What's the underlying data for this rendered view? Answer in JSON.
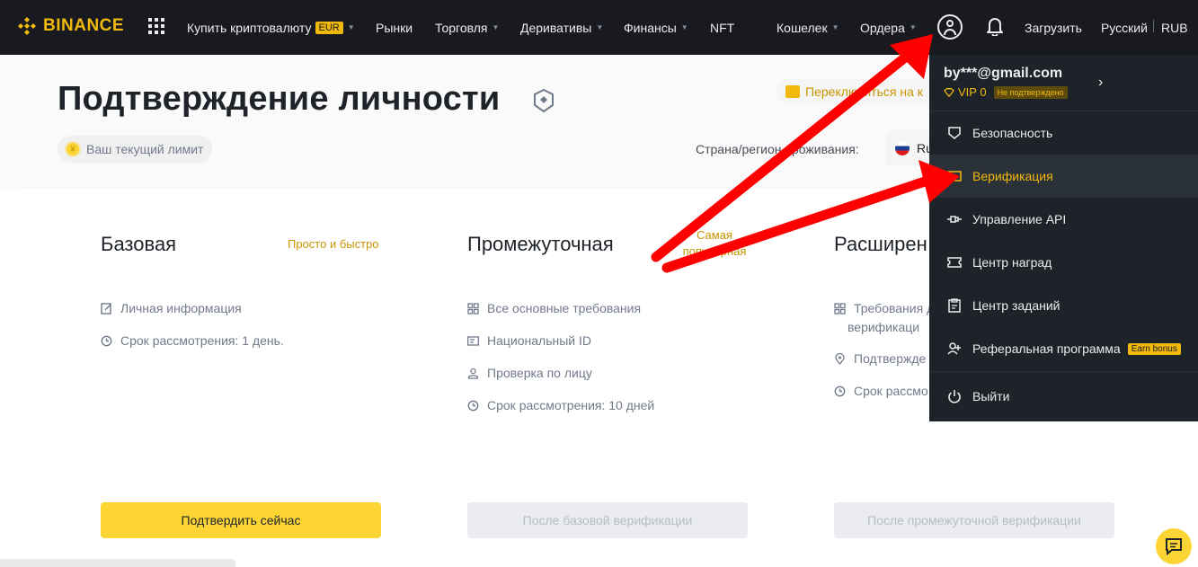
{
  "brand": {
    "name": "BINANCE",
    "color": "#f0b90b"
  },
  "nav": {
    "buy_crypto": "Купить криптовалюту",
    "buy_crypto_badge": "EUR",
    "markets": "Рынки",
    "trade": "Торговля",
    "derivatives": "Деривативы",
    "finance": "Финансы",
    "nft": "NFT",
    "wallet": "Кошелек",
    "orders": "Ордера",
    "download": "Загрузить",
    "language": "Русский",
    "currency": "RUB"
  },
  "header": {
    "title": "Подтверждение личности",
    "limit_label": "Ваш текущий лимит",
    "switch_label": "Переключиться на к",
    "country_label": "Страна/регион проживания:",
    "country_value": "Ru"
  },
  "tiers": [
    {
      "title": "Базовая",
      "tag": "Просто и быстро",
      "requirements": [
        "Личная информация",
        "Срок рассмотрения: 1 день."
      ],
      "button": "Подтвердить сейчас"
    },
    {
      "title": "Промежуточная",
      "tag_line1": "Самая",
      "tag_line2": "популярная",
      "requirements": [
        "Все основные требования",
        "Национальный ID",
        "Проверка по лицу",
        "Срок рассмотрения: 10 дней"
      ],
      "button": "После базовой верификации"
    },
    {
      "title": "Расширен",
      "requirements_line1": "Требования д",
      "requirements_line2": "верификаци",
      "requirements": [
        "Подтвержде",
        "Срок рассмо"
      ],
      "button": "После промежуточной верификации"
    }
  ],
  "dropdown": {
    "email": "by***@gmail.com",
    "vip": "VIP 0",
    "status": "Не подтверждено",
    "items": [
      {
        "label": "Безопасность",
        "icon": "shield-icon"
      },
      {
        "label": "Верификация",
        "icon": "id-card-icon",
        "active": true
      },
      {
        "label": "Управление API",
        "icon": "api-icon"
      },
      {
        "label": "Центр наград",
        "icon": "ticket-icon"
      },
      {
        "label": "Центр заданий",
        "icon": "clipboard-icon"
      },
      {
        "label": "Реферальная программа",
        "icon": "add-user-icon",
        "badge": "Earn bonus"
      },
      {
        "label": "Выйти",
        "icon": "power-icon"
      }
    ]
  },
  "status_bar": {
    "url": "https://www.binance.com/ru/settings/profile"
  },
  "colors": {
    "accent": "#f0b90b",
    "nav_bg": "#181a20",
    "dropdown_bg": "#1e2329",
    "arrow": "#ff0000"
  }
}
